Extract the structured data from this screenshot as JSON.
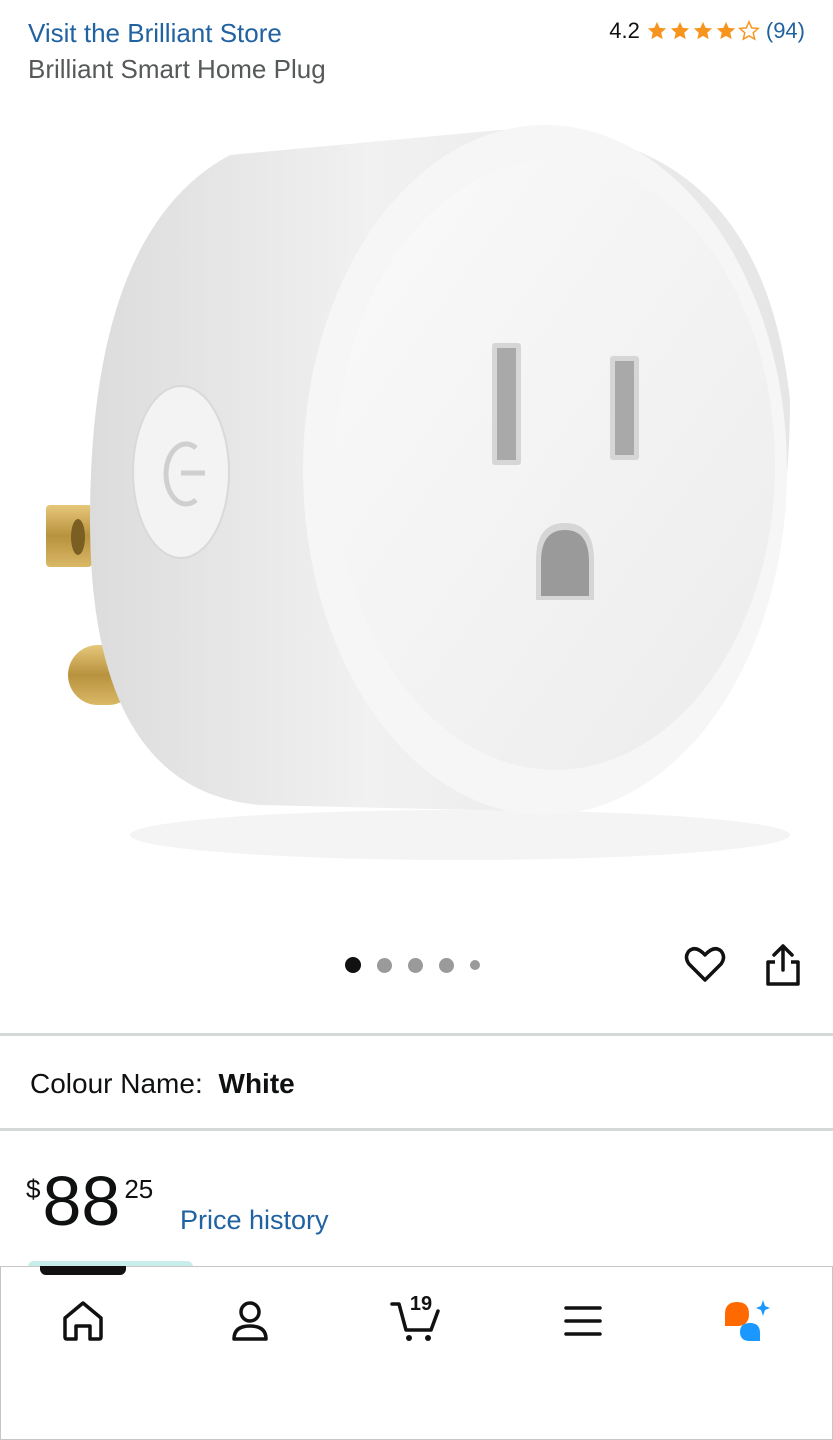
{
  "header": {
    "store_link": "Visit the Brilliant Store",
    "product_title": "Brilliant Smart Home Plug",
    "rating_value": "4.2",
    "rating_count": "(94)",
    "stars_filled": 4.2,
    "star_color": "#f7941d"
  },
  "gallery": {
    "image_count": 5,
    "active_index": 0,
    "wishlist_icon": "heart-icon",
    "share_icon": "share-icon"
  },
  "variation": {
    "label": "Colour Name:",
    "value": "White"
  },
  "price": {
    "symbol": "$",
    "whole": "88",
    "fraction": "25",
    "history_link": "Price history"
  },
  "bottom_nav": {
    "items": [
      "home-icon",
      "account-icon",
      "cart-icon",
      "menu-icon",
      "assistant-icon"
    ],
    "cart_count": "19",
    "accent_orange": "#ff6a00",
    "accent_blue": "#1a98ff"
  }
}
